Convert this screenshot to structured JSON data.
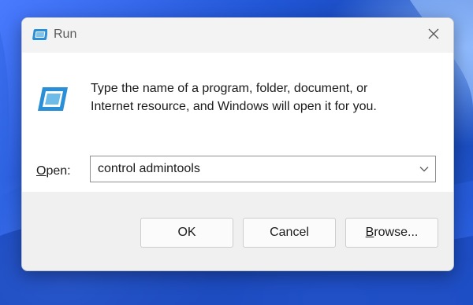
{
  "window": {
    "title": "Run",
    "icon": "run-icon",
    "close_icon": "close-icon"
  },
  "dialog": {
    "description_line1": "Type the name of a program, folder, document, or",
    "description_line2": "Internet resource, and Windows will open it for you.",
    "open_label_mnemonic": "O",
    "open_label_rest": "pen:",
    "open_value": "control admintools",
    "dropdown_icon": "chevron-down-icon"
  },
  "buttons": {
    "ok": "OK",
    "cancel": "Cancel",
    "browse_mnemonic": "B",
    "browse_rest": "rowse..."
  },
  "colors": {
    "accent": "#1d4fc2",
    "icon_blue": "#2a8fd6"
  }
}
